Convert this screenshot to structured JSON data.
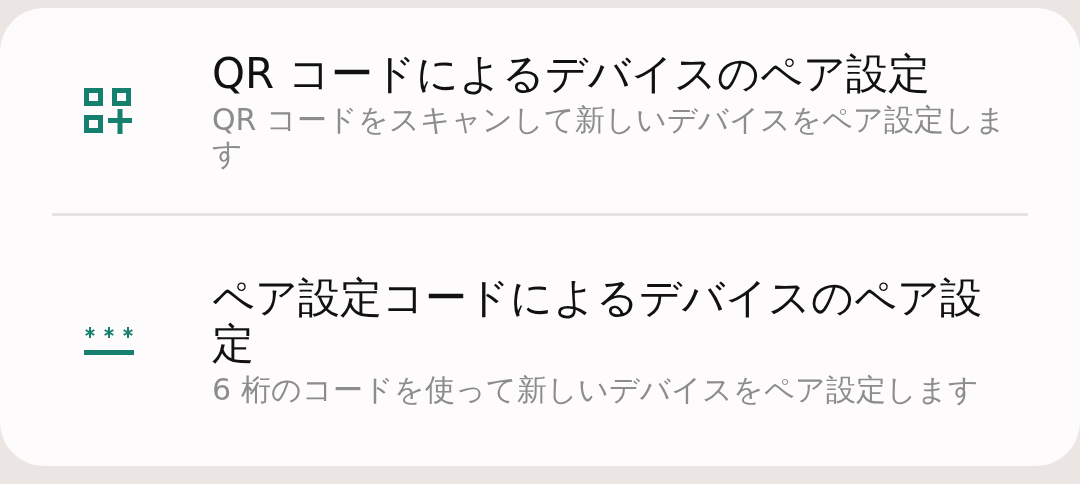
{
  "options": [
    {
      "kind": "qr",
      "title": "QR コードによるデバイスのペア設定",
      "summary": "QR コードをスキャンして新しいデバイスをペア設定します"
    },
    {
      "kind": "code",
      "title": "ペア設定コードによるデバイスのペア設定",
      "summary": "6 桁のコードを使って新しいデバイスをペア設定します"
    }
  ]
}
